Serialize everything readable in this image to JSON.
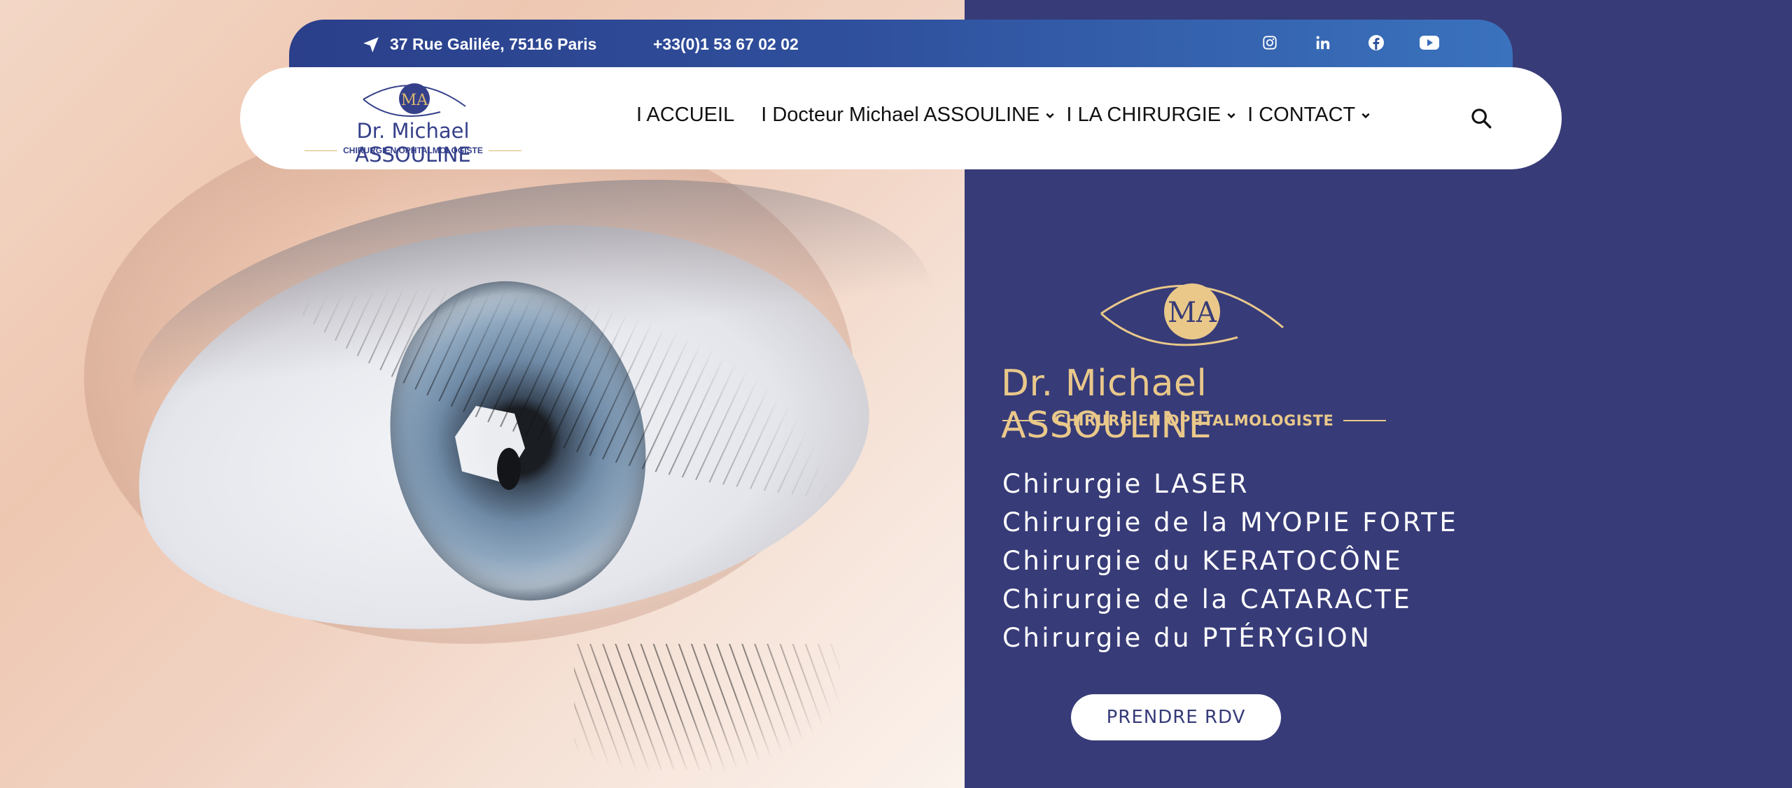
{
  "topbar": {
    "address": "37 Rue Galilée, 75116 Paris",
    "phone": "+33(0)1 53 67 02 02",
    "socials": [
      "instagram-icon",
      "linkedin-icon",
      "facebook-icon",
      "youtube-icon"
    ]
  },
  "brand": {
    "name": "Dr. Michael ASSOULINE",
    "subtitle": "CHIRURGIEN OPHTALMOLOGISTE",
    "monogram": "MA"
  },
  "nav": {
    "items": [
      {
        "label": "I ACCUEIL",
        "dropdown": false
      },
      {
        "label": "I Docteur Michael ASSOULINE",
        "dropdown": true
      },
      {
        "label": "I LA CHIRURGIE",
        "dropdown": true
      },
      {
        "label": "I CONTACT",
        "dropdown": true
      }
    ],
    "search_icon": "search-icon"
  },
  "hero": {
    "name": "Dr. Michael ASSOULINE",
    "subtitle": "CHIRURGIEN OPHTALMOLOGISTE",
    "services": [
      "Chirurgie LASER",
      "Chirurgie de la MYOPIE FORTE",
      "Chirurgie du KERATOCÔNE",
      "Chirurgie de la CATARACTE",
      "Chirurgie du PTÉRYGION"
    ],
    "cta": "PRENDRE RDV"
  },
  "colors": {
    "panel": "#373b78",
    "gold": "#e9c88a",
    "navy": "#35408a",
    "topbar_start": "#2b3f8a",
    "topbar_end": "#3a72bd"
  }
}
